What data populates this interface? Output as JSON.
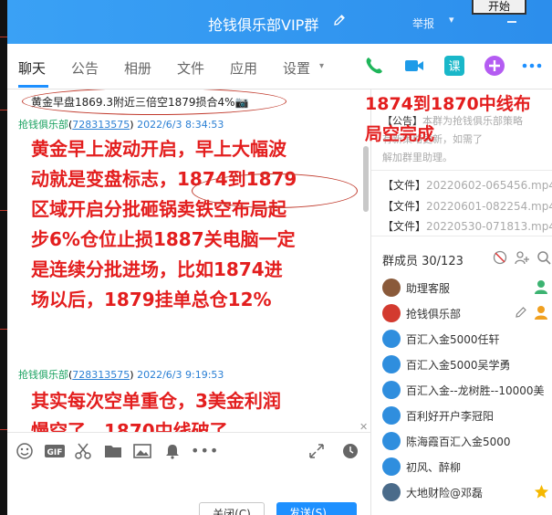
{
  "window": {
    "title": "抢钱俱乐部VIP群",
    "report_label": "举报",
    "start_button": "开始"
  },
  "tabs": [
    {
      "label": "聊天",
      "active": true
    },
    {
      "label": "公告",
      "active": false
    },
    {
      "label": "相册",
      "active": false
    },
    {
      "label": "文件",
      "active": false
    },
    {
      "label": "应用",
      "active": false
    },
    {
      "label": "设置",
      "active": false
    }
  ],
  "toolbar_icons": [
    "phone-icon",
    "video-icon",
    "course-icon",
    "add-app-icon",
    "more-icon"
  ],
  "toolbar_course_label": "课",
  "chat": {
    "pinned_message": "黄金早盘1869.3附近三倍空1879损合4%📷",
    "messages": [
      {
        "sender": "抢钱俱乐部",
        "qq": "728313575",
        "time": "2022/6/3 8:34:53",
        "lines": [
          "黄金早上波动开启，早上大幅波",
          "动就是变盘标志，1874到1879",
          "区域开启分批砸锅卖铁空布局起",
          "步6%仓位止损1887关电脑一定",
          "是连续分批进场，比如1874进",
          "场以后，1879挂单总仓12%"
        ]
      },
      {
        "sender": "抢钱俱乐部",
        "qq": "728313575",
        "time": "2022/6/3 9:19:53",
        "lines": [
          "其实每次空单重仓，3美金利润",
          "慢空了，1870中线破了"
        ]
      }
    ]
  },
  "annotation": {
    "lines": [
      "1874到1870中线布",
      "局空完成"
    ]
  },
  "notice": {
    "label": "【公告】",
    "text_1": "本群为抢钱俱乐部策略",
    "text_2": "有新策略更新，如需了",
    "text_3": "解加群里助理。"
  },
  "files": [
    {
      "label": "【文件】",
      "name": "20220602-065456.mp4"
    },
    {
      "label": "【文件】",
      "name": "20220601-082254.mp4"
    },
    {
      "label": "【文件】",
      "name": "20220530-071813.mp4"
    }
  ],
  "members": {
    "header": "群成员 30/123",
    "list": [
      {
        "name": "助理客服",
        "color": "#8a5a3a"
      },
      {
        "name": "抢钱俱乐部",
        "color": "#d33a2f"
      },
      {
        "name": "百汇入金5000任轩",
        "color": "#2f8ede"
      },
      {
        "name": "百汇入金5000吴学勇",
        "color": "#2f8ede"
      },
      {
        "name": "百汇入金--龙树胜--10000美",
        "color": "#2f8ede"
      },
      {
        "name": "百利好开户李冠阳",
        "color": "#2f8ede"
      },
      {
        "name": "陈海霞百汇入金5000",
        "color": "#2f8ede"
      },
      {
        "name": "初风、醉柳",
        "color": "#2f8ede"
      },
      {
        "name": "大地财险@邓磊",
        "color": "#4a6b8a"
      }
    ]
  },
  "buttons": {
    "close": "关闭(C)",
    "send": "发送(S)"
  }
}
